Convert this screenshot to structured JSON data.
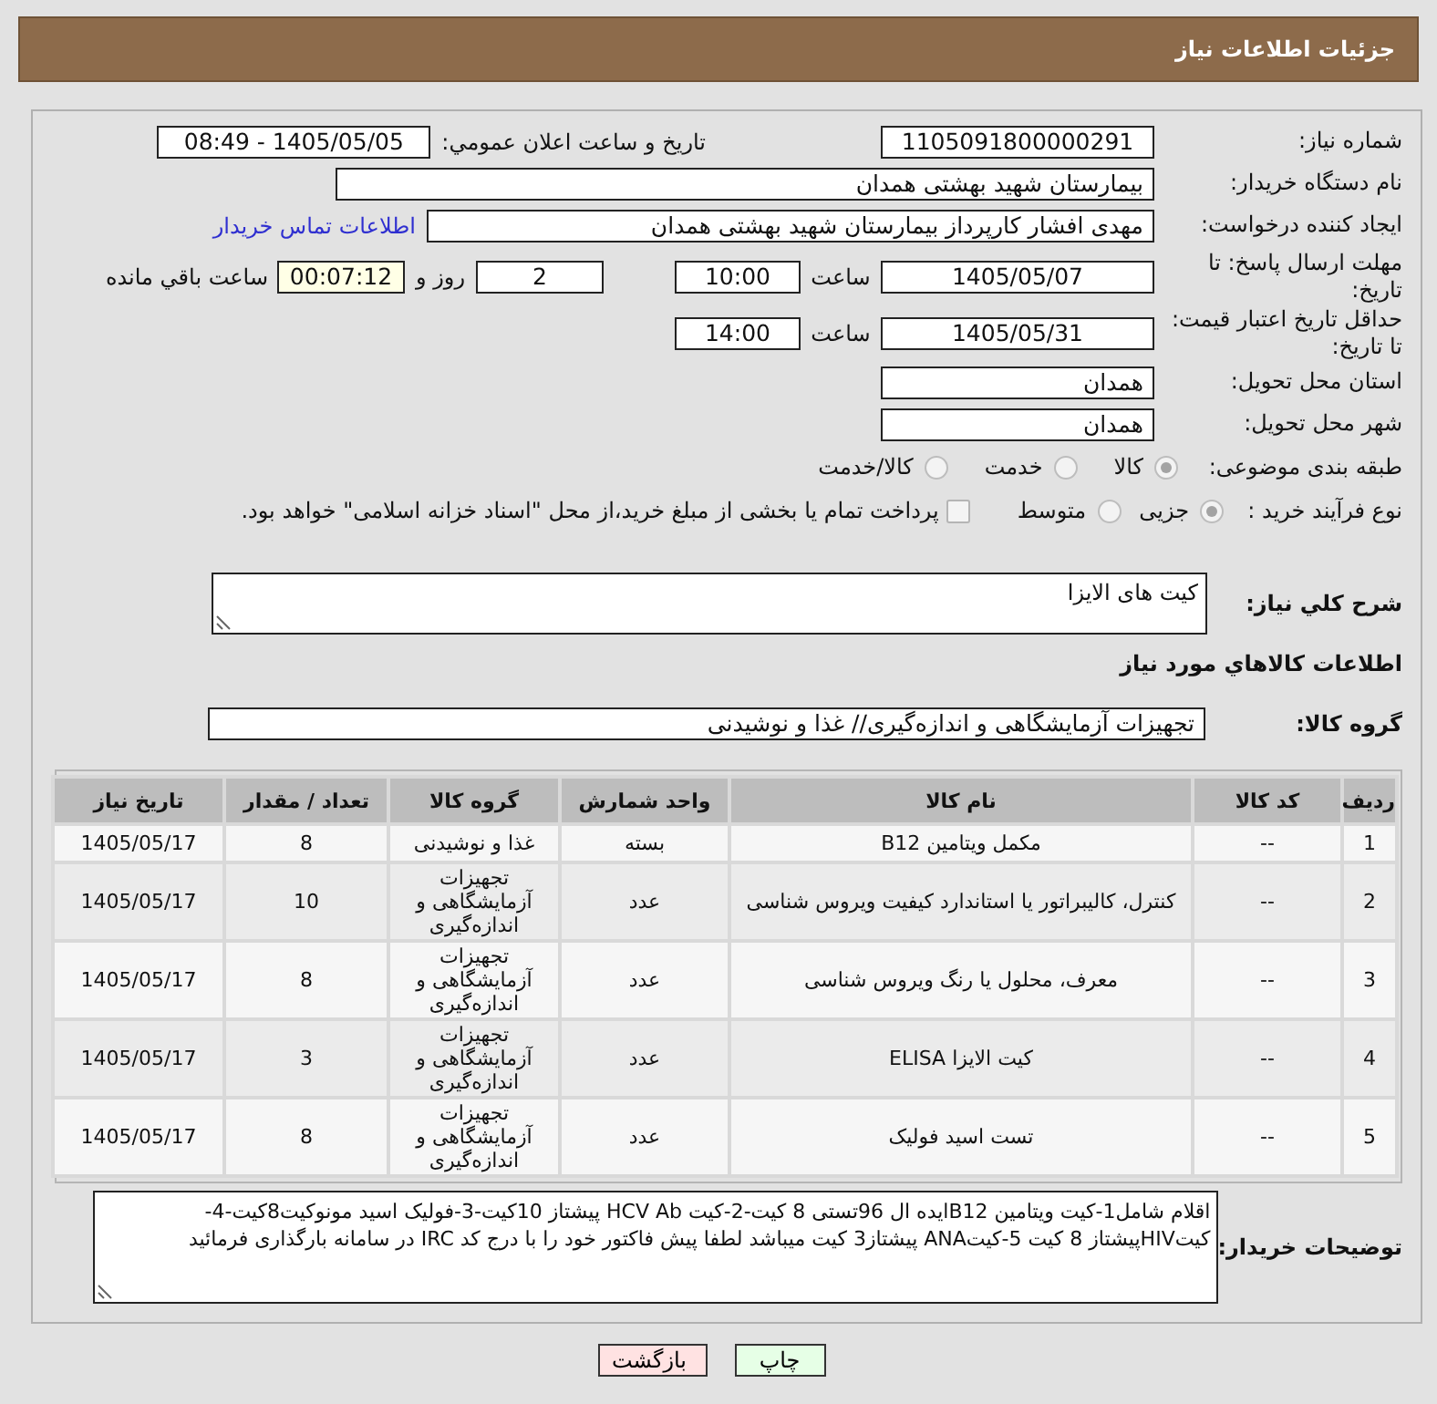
{
  "header": {
    "title": "جزئیات اطلاعات نیاز"
  },
  "form": {
    "need_number": {
      "label": "شماره نیاز:",
      "value": "1105091800000291"
    },
    "announce": {
      "label": "تاریخ و ساعت اعلان عمومي:",
      "value": "1405/05/05 - 08:49"
    },
    "buyer_org": {
      "label": "نام دستگاه خریدار:",
      "value": "بیمارستان شهید بهشتی همدان"
    },
    "creator": {
      "label": "ایجاد کننده درخواست:",
      "value": "مهدی افشار کارپرداز بیمارستان شهید بهشتی همدان",
      "link": "اطلاعات تماس خریدار"
    },
    "reply_deadline": {
      "label": "مهلت ارسال پاسخ: تا تاریخ:",
      "date": "1405/05/07",
      "time_label": "ساعت",
      "time": "10:00",
      "days": "2",
      "days_label": "روز و",
      "remaining": "00:07:12",
      "remaining_label": "ساعت باقي مانده"
    },
    "price_validity": {
      "label": "حداقل تاریخ اعتبار قیمت: تا تاریخ:",
      "date": "1405/05/31",
      "time_label": "ساعت",
      "time": "14:00"
    },
    "province": {
      "label": "استان محل تحویل:",
      "value": "همدان"
    },
    "city": {
      "label": "شهر محل تحویل:",
      "value": "همدان"
    },
    "category": {
      "label": "طبقه بندی موضوعی:",
      "options": [
        {
          "label": "کالا",
          "selected": true
        },
        {
          "label": "خدمت",
          "selected": false
        },
        {
          "label": "کالا/خدمت",
          "selected": false
        }
      ]
    },
    "process": {
      "label": "نوع فرآیند خرید :",
      "options": [
        {
          "label": "جزیی",
          "selected": true
        },
        {
          "label": "متوسط",
          "selected": false
        }
      ],
      "treasury": {
        "label": "پرداخت تمام یا بخشی از مبلغ خرید،از محل \"اسناد خزانه اسلامی\" خواهد بود.",
        "checked": false
      }
    }
  },
  "summary": {
    "label": "شرح كلي نياز:",
    "value": "کیت های الایزا"
  },
  "goods_title": "اطلاعات کالاهاي مورد نياز",
  "goods_group": {
    "label": "گروه کالا:",
    "value": "تجهیزات آزمایشگاهی و اندازه‌گیری// غذا و نوشیدنی"
  },
  "table": {
    "columns": [
      "ردیف",
      "کد کالا",
      "نام کالا",
      "واحد شمارش",
      "گروه کالا",
      "تعداد / مقدار",
      "تاریخ نیاز"
    ],
    "rows": [
      [
        "1",
        "--",
        "مکمل ویتامین B12",
        "بسته",
        "غذا و نوشیدنی",
        "8",
        "1405/05/17"
      ],
      [
        "2",
        "--",
        "کنترل، کالیبراتور یا استاندارد کیفیت ویروس شناسی",
        "عدد",
        "تجهیزات آزمایشگاهی و اندازه‌گیری",
        "10",
        "1405/05/17"
      ],
      [
        "3",
        "--",
        "معرف، محلول یا رنگ ویروس شناسی",
        "عدد",
        "تجهیزات آزمایشگاهی و اندازه‌گیری",
        "8",
        "1405/05/17"
      ],
      [
        "4",
        "--",
        "کیت الایزا ELISA",
        "عدد",
        "تجهیزات آزمایشگاهی و اندازه‌گیری",
        "3",
        "1405/05/17"
      ],
      [
        "5",
        "--",
        "تست اسید فولیک",
        "عدد",
        "تجهیزات آزمایشگاهی و اندازه‌گیری",
        "8",
        "1405/05/17"
      ]
    ]
  },
  "buyer_notes": {
    "label": "توضیحات خریدار:",
    "value": "اقلام شامل1-کیت ویتامین B12ایده ال 96تستی 8 کیت-2-کیت HCV Ab پیشتاز 10کیت-3-فولیک اسید مونوکیت8کیت-4-کیتHIVپیشتاز 8 کیت 5-کیتANA پیشتاز3 کیت میباشد لطفا پیش فاکتور خود را با درج کد IRC در سامانه بارگذاری فرمائید"
  },
  "buttons": [
    {
      "label": "چاپ",
      "kind": "print"
    },
    {
      "label": "بازگشت",
      "kind": "back"
    }
  ]
}
